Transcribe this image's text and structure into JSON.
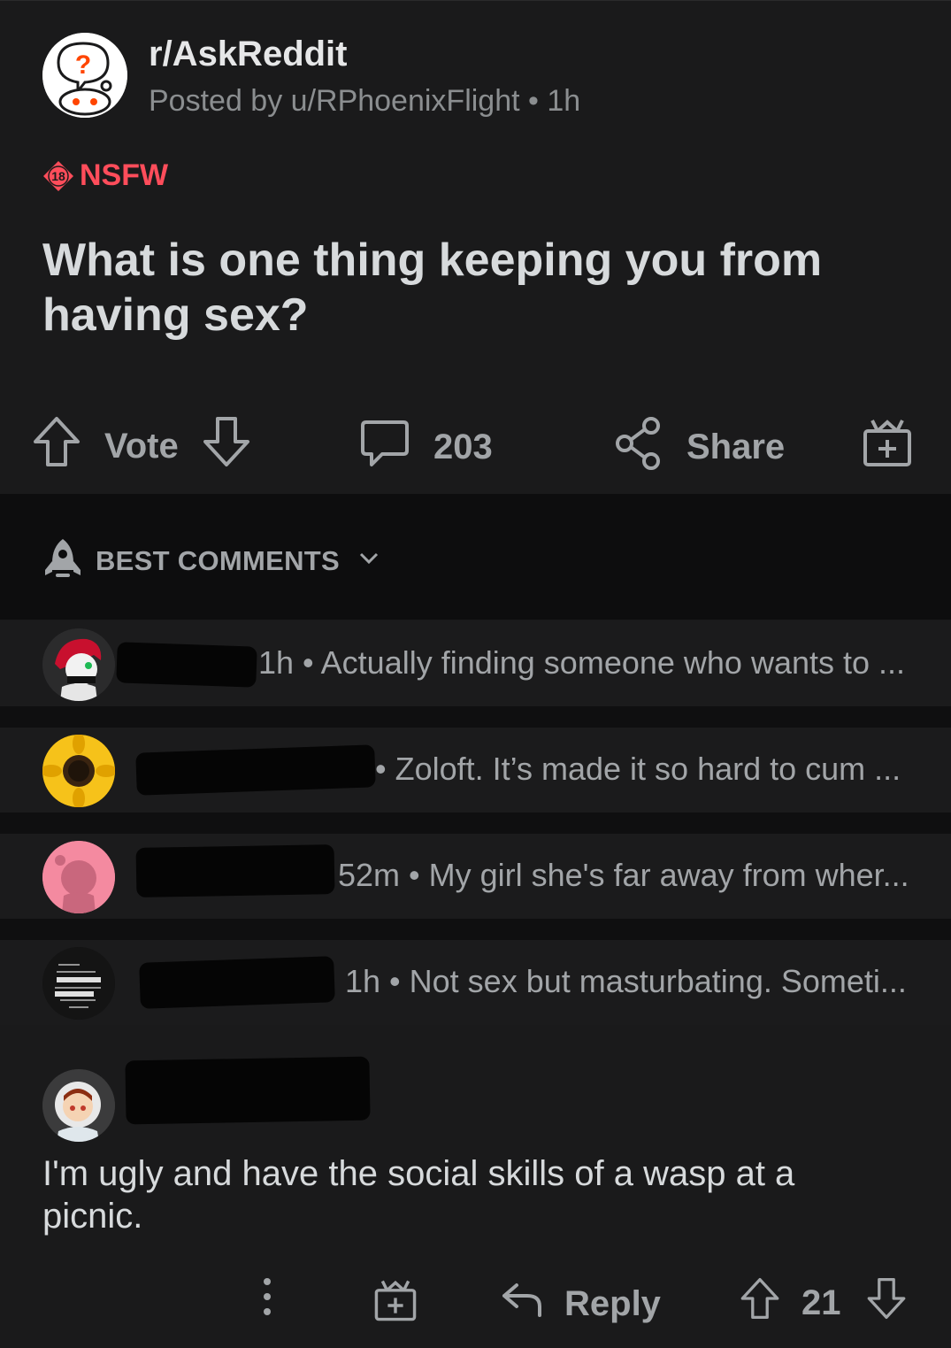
{
  "post": {
    "subreddit": "r/AskReddit",
    "posted_by": "Posted by u/RPhoenixFlight • 1h",
    "nsfw_age": "18",
    "nsfw_label": "NSFW",
    "title": "What is one thing keeping you from having sex?"
  },
  "actions": {
    "vote_label": "Vote",
    "comment_count": "203",
    "share_label": "Share"
  },
  "sort": {
    "label": "BEST COMMENTS"
  },
  "comments": [
    {
      "meta": "1h • Actually finding someone who wants to ..."
    },
    {
      "meta": "• Zoloft. It’s made it so hard to cum ..."
    },
    {
      "meta": "52m • My girl she's far away from wher..."
    },
    {
      "meta": "1h • Not sex but masturbating. Someti..."
    }
  ],
  "expanded_comment": {
    "body": "I'm ugly and have the social skills of a wasp at a picnic.",
    "reply_label": "Reply",
    "score": "21"
  },
  "colors": {
    "background": "#1a1a1b",
    "nsfw": "#ff4d5b",
    "muted": "#a2a5a8"
  }
}
